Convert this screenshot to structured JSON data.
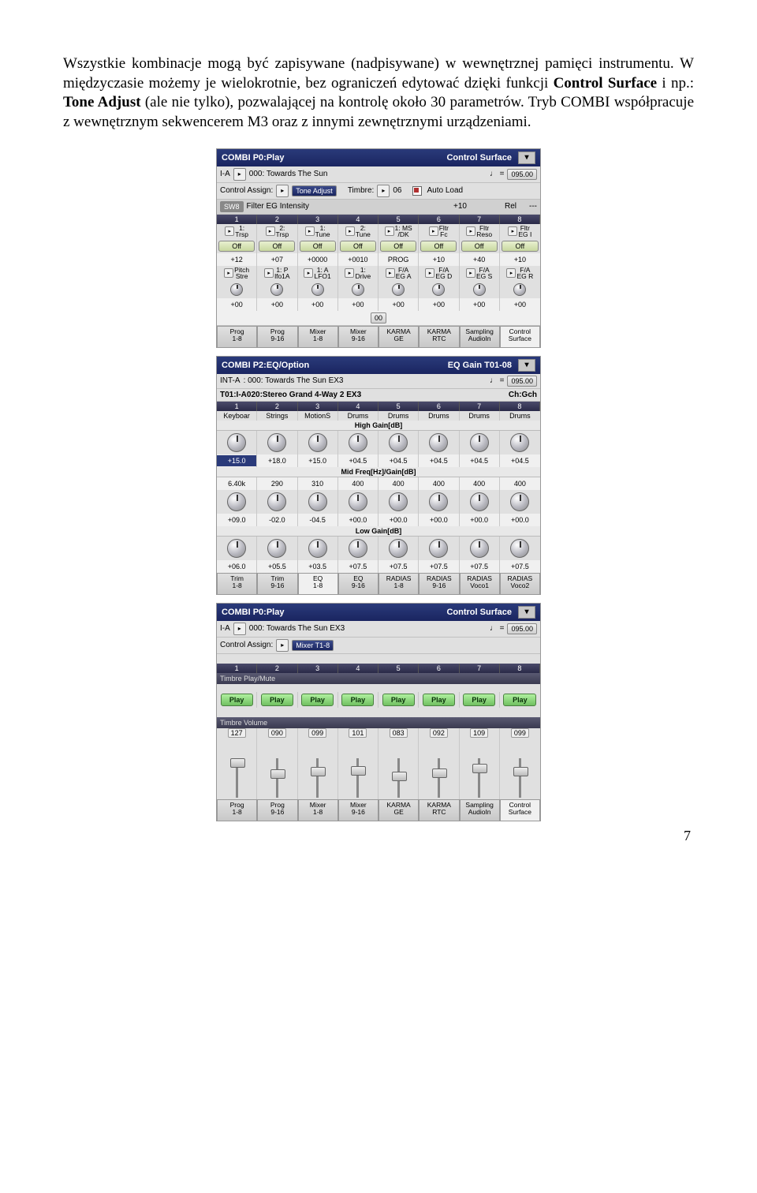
{
  "paragraph": {
    "t1": "Wszystkie kombinacje mogą być zapisywane (nadpisywane) w wewnętrznej pamięci instrumentu. W międzyczasie możemy je wielokrotnie, bez ograniczeń edytować dzięki funkcji ",
    "b1": "Control Surface",
    "t2": " i np.: ",
    "b2": "Tone Adjust",
    "t3": " (ale nie tylko), pozwalającej na kontrolę około 30 parametrów. Tryb COMBI współpracuje z wewnętrznym sekwencerem M3 oraz z innymi zewnętrznymi urządzeniami."
  },
  "shot1": {
    "title_left": "COMBI  P0:Play",
    "title_right": "Control Surface",
    "bank": "I-A",
    "prog": "000: Towards The Sun",
    "tempo_lbl": "♩ =",
    "tempo": "095.00",
    "ca_lbl": "Control Assign:",
    "ca_val": "Tone Adjust",
    "timbre_lbl": "Timbre:",
    "timbre_val": "06",
    "auto_lbl": "Auto Load",
    "sw_lbl": "SW8",
    "sw_name": "Filter EG Intensity",
    "sw_val": "+10",
    "rel_lbl": "Rel",
    "rel_val": "---",
    "cols": [
      "1",
      "2",
      "3",
      "4",
      "5",
      "6",
      "7",
      "8"
    ],
    "knob_row1": [
      "1:\nTrsp",
      "2:\nTrsp",
      "1:\nTune",
      "2:\nTune",
      "1: MS\n/DK",
      "Fltr\nFc",
      "Fltr\nReso",
      "Fltr\nEG I"
    ],
    "off": "Off",
    "vals1": [
      "+12",
      "+07",
      "+0000",
      "+0010",
      "PROG",
      "+10",
      "+40",
      "+10"
    ],
    "knob_row2": [
      "Pitch\nStre",
      "1: P\nlfo1A",
      "1: A\nLFO1",
      "1:\nDrive",
      "F/A\nEG A",
      "F/A\nEG D",
      "F/A\nEG S",
      "F/A\nEG R"
    ],
    "vals2": [
      "+00",
      "+00",
      "+00",
      "+00",
      "+00",
      "+00",
      "+00",
      "+00"
    ],
    "midval": "00",
    "tabs": [
      "Prog\n1-8",
      "Prog\n9-16",
      "Mixer\n1-8",
      "Mixer\n9-16",
      "KARMA\nGE",
      "KARMA\nRTC",
      "Sampling\nAudioIn",
      "Control\nSurface"
    ]
  },
  "shot2": {
    "title_left": "COMBI  P2:EQ/Option",
    "title_right": "EQ Gain T01-08",
    "bank": "INT-A",
    "prog": ": 000: Towards The Sun    EX3",
    "tempo_lbl": "♩ =",
    "tempo": "095.00",
    "t01": "T01:I-A020:Stereo Grand 4-Way 2 EX3",
    "ch_lbl": "Ch:Gch",
    "cats": [
      "Keyboar",
      "Strings",
      "MotionS",
      "Drums",
      "Drums",
      "Drums",
      "Drums",
      "Drums"
    ],
    "hg_lbl": "High Gain[dB]",
    "hg": [
      "+15.0",
      "+18.0",
      "+15.0",
      "+04.5",
      "+04.5",
      "+04.5",
      "+04.5",
      "+04.5"
    ],
    "hg_sel_idx": 0,
    "mf_lbl": "Mid Freq[Hz]/Gain[dB]",
    "mf": [
      "6.40k",
      "290",
      "310",
      "400",
      "400",
      "400",
      "400",
      "400"
    ],
    "mg": [
      "+09.0",
      "-02.0",
      "-04.5",
      "+00.0",
      "+00.0",
      "+00.0",
      "+00.0",
      "+00.0"
    ],
    "lg_lbl": "Low Gain[dB]",
    "lg": [
      "+06.0",
      "+05.5",
      "+03.5",
      "+07.5",
      "+07.5",
      "+07.5",
      "+07.5",
      "+07.5"
    ],
    "tabs": [
      "Trim\n1-8",
      "Trim\n9-16",
      "EQ\n1-8",
      "EQ\n9-16",
      "RADIAS\n1-8",
      "RADIAS\n9-16",
      "RADIAS\nVoco1",
      "RADIAS\nVoco2"
    ]
  },
  "shot3": {
    "title_left": "COMBI  P0:Play",
    "title_right": "Control Surface",
    "bank": "I-A",
    "prog": "000: Towards The Sun    EX3",
    "tempo_lbl": "♩ =",
    "tempo": "095.00",
    "ca_lbl": "Control Assign:",
    "ca_val": "Mixer T1-8",
    "pm_lbl": "Timbre Play/Mute",
    "play": "Play",
    "vol_lbl": "Timbre Volume",
    "vols": [
      "127",
      "090",
      "099",
      "101",
      "083",
      "092",
      "109",
      "099"
    ],
    "cols": [
      "1",
      "2",
      "3",
      "4",
      "5",
      "6",
      "7",
      "8"
    ],
    "tabs": [
      "Prog\n1-8",
      "Prog\n9-16",
      "Mixer\n1-8",
      "Mixer\n9-16",
      "KARMA\nGE",
      "KARMA\nRTC",
      "Sampling\nAudioIn",
      "Control\nSurface"
    ]
  },
  "pagenum": "7"
}
